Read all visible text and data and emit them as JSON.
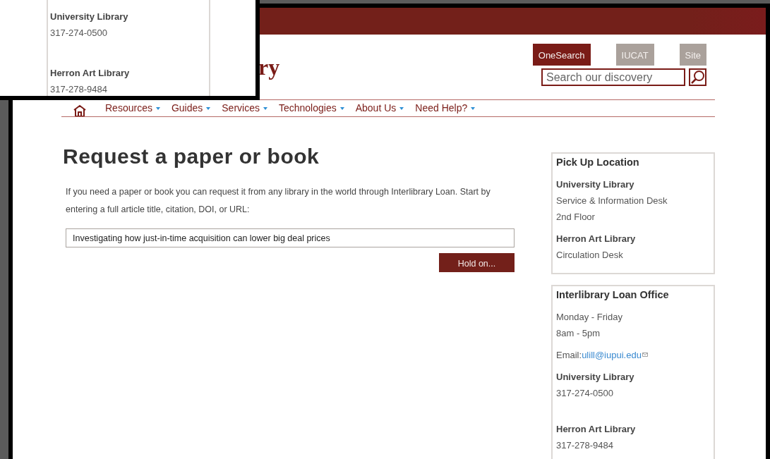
{
  "callout": {
    "entries": [
      {
        "name": "University Library",
        "phone": "317-274-0500"
      },
      {
        "name": "Herron Art Library",
        "phone": "317-278-9484"
      }
    ]
  },
  "header": {
    "logo_text": "ry",
    "search_tabs": [
      {
        "label": "OneSearch",
        "selected": true
      },
      {
        "label": "IUCAT",
        "selected": false
      },
      {
        "label": "Site",
        "selected": false
      }
    ],
    "search": {
      "placeholder": "Search our discovery"
    }
  },
  "nav": {
    "items": [
      {
        "label": "Resources"
      },
      {
        "label": "Guides"
      },
      {
        "label": "Services"
      },
      {
        "label": "Technologies"
      },
      {
        "label": "About Us"
      },
      {
        "label": "Need Help?"
      }
    ]
  },
  "main": {
    "title": "Request a paper or book",
    "intro": "If you need a paper or book you can request it from any library in the world through Interlibrary Loan. Start by entering a full article title, citation, DOI, or URL:",
    "query": {
      "value": "Investigating how just-in-time acquisition can lower big deal prices"
    },
    "submit_button": "Hold on..."
  },
  "sidebar": [
    {
      "title": "Pick Up Location",
      "blocks": [
        {
          "kind": "place",
          "name": "University Library",
          "lines": [
            "Service & Information Desk",
            "2nd Floor"
          ]
        },
        {
          "kind": "place",
          "name": "Herron Art Library",
          "lines": [
            "Circulation Desk"
          ]
        }
      ]
    },
    {
      "title": "Interlibrary Loan Office",
      "blocks": [
        {
          "kind": "hours",
          "lines": [
            "Monday - Friday",
            "8am - 5pm"
          ]
        },
        {
          "kind": "email",
          "label": "Email:",
          "email": "ulill@iupui.edu"
        },
        {
          "kind": "phone",
          "name": "University Library",
          "lines": [
            "317-274-0500"
          ]
        },
        {
          "kind": "phone",
          "name": "Herron Art Library",
          "lines": [
            "317-278-9484"
          ]
        }
      ]
    }
  ]
}
